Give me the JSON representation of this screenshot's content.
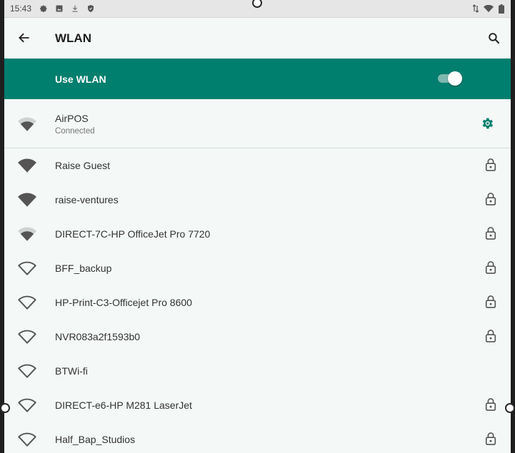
{
  "status_bar": {
    "time": "15:43",
    "left_icons": [
      "gear-icon",
      "image-icon",
      "download-icon",
      "shield-icon"
    ],
    "right_icons": [
      "data-arrows-icon",
      "wifi-icon",
      "battery-icon"
    ]
  },
  "header": {
    "title": "WLAN",
    "back_icon": "back-arrow-icon",
    "search_icon": "search-icon"
  },
  "use_wlan": {
    "label": "Use WLAN",
    "enabled": true,
    "bar_color": "#007e6e"
  },
  "connected_network": {
    "name": "AirPOS",
    "status": "Connected",
    "signal": "medium",
    "settings_icon": "gear-icon",
    "accent": "#007e6e"
  },
  "networks": [
    {
      "name": "Raise Guest",
      "signal": "full",
      "locked": true
    },
    {
      "name": "raise-ventures",
      "signal": "full",
      "locked": true
    },
    {
      "name": "DIRECT-7C-HP OfficeJet Pro 7720",
      "signal": "medium",
      "locked": true
    },
    {
      "name": "BFF_backup",
      "signal": "low",
      "locked": true
    },
    {
      "name": "HP-Print-C3-Officejet Pro 8600",
      "signal": "low",
      "locked": true
    },
    {
      "name": "NVR083a2f1593b0",
      "signal": "low",
      "locked": true
    },
    {
      "name": "BTWi-fi",
      "signal": "low",
      "locked": false
    },
    {
      "name": "DIRECT-e6-HP M281 LaserJet",
      "signal": "low",
      "locked": true
    },
    {
      "name": "Half_Bap_Studios",
      "signal": "low",
      "locked": true
    }
  ]
}
